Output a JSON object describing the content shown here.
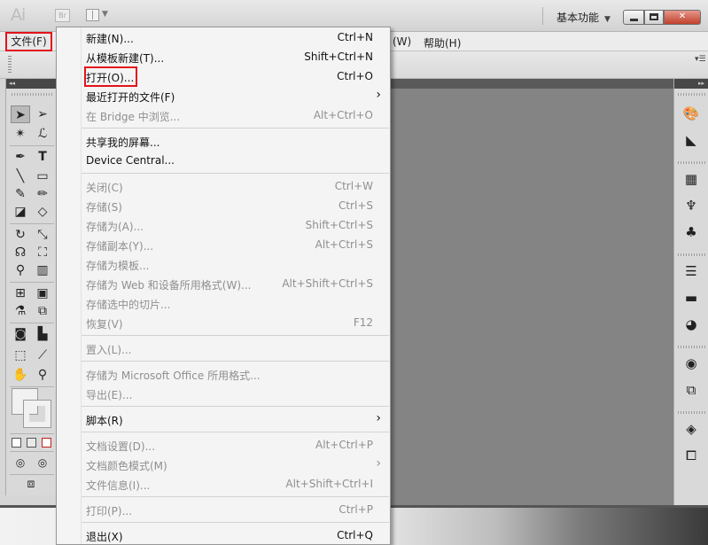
{
  "app": {
    "logo": "Ai",
    "bridge_label": "Br",
    "workspace": "基本功能"
  },
  "menubar": {
    "file": "文件(F)",
    "window": "(W)",
    "help": "帮助(H)"
  },
  "file_menu": {
    "items": [
      {
        "label": "新建(N)...",
        "shortcut": "Ctrl+N",
        "enabled": true
      },
      {
        "label": "从模板新建(T)...",
        "shortcut": "Shift+Ctrl+N",
        "enabled": true
      },
      {
        "label": "打开(O)...",
        "shortcut": "Ctrl+O",
        "enabled": true,
        "highlighted": true
      },
      {
        "label": "最近打开的文件(F)",
        "shortcut": "",
        "enabled": true,
        "submenu": true
      },
      {
        "label": "在 Bridge 中浏览...",
        "shortcut": "Alt+Ctrl+O",
        "enabled": false
      },
      {
        "label": "共享我的屏幕...",
        "shortcut": "",
        "enabled": true
      },
      {
        "label": "Device Central...",
        "shortcut": "",
        "enabled": true
      },
      {
        "label": "关闭(C)",
        "shortcut": "Ctrl+W",
        "enabled": false
      },
      {
        "label": "存储(S)",
        "shortcut": "Ctrl+S",
        "enabled": false
      },
      {
        "label": "存储为(A)...",
        "shortcut": "Shift+Ctrl+S",
        "enabled": false
      },
      {
        "label": "存储副本(Y)...",
        "shortcut": "Alt+Ctrl+S",
        "enabled": false
      },
      {
        "label": "存储为模板...",
        "shortcut": "",
        "enabled": false
      },
      {
        "label": "存储为 Web 和设备所用格式(W)...",
        "shortcut": "Alt+Shift+Ctrl+S",
        "enabled": false
      },
      {
        "label": "存储选中的切片...",
        "shortcut": "",
        "enabled": false
      },
      {
        "label": "恢复(V)",
        "shortcut": "F12",
        "enabled": false
      },
      {
        "label": "置入(L)...",
        "shortcut": "",
        "enabled": false
      },
      {
        "label": "存储为 Microsoft Office 所用格式...",
        "shortcut": "",
        "enabled": false
      },
      {
        "label": "导出(E)...",
        "shortcut": "",
        "enabled": false
      },
      {
        "label": "脚本(R)",
        "shortcut": "",
        "enabled": true,
        "submenu": true
      },
      {
        "label": "文档设置(D)...",
        "shortcut": "Alt+Ctrl+P",
        "enabled": false
      },
      {
        "label": "文档颜色模式(M)",
        "shortcut": "",
        "enabled": false,
        "submenu": true
      },
      {
        "label": "文件信息(I)...",
        "shortcut": "Alt+Shift+Ctrl+I",
        "enabled": false
      },
      {
        "label": "打印(P)...",
        "shortcut": "Ctrl+P",
        "enabled": false
      },
      {
        "label": "退出(X)",
        "shortcut": "Ctrl+Q",
        "enabled": true
      }
    ]
  },
  "toolbar": {
    "tools": [
      "selection-tool",
      "direct-selection-tool",
      "magic-wand-tool",
      "lasso-tool",
      "pen-tool",
      "type-tool",
      "line-segment-tool",
      "rectangle-tool",
      "paintbrush-tool",
      "pencil-tool",
      "blob-brush-tool",
      "eraser-tool",
      "rotate-tool",
      "scale-tool",
      "warp-tool",
      "free-transform-tool",
      "shape-builder-tool",
      "symbol-sprayer-tool",
      "mesh-tool",
      "gradient-tool",
      "eyedropper-tool",
      "blend-tool",
      "live-paint-tool",
      "column-graph-tool",
      "artboard-tool",
      "slice-tool",
      "hand-tool",
      "zoom-tool"
    ]
  },
  "dock": {
    "icons": [
      "color-guide-icon",
      "swatches-icon",
      "brushes-icon",
      "symbols-icon",
      "graphic-styles-icon",
      "stroke-icon",
      "gradient-icon",
      "transparency-icon",
      "appearance-icon",
      "align-icon",
      "layers-icon",
      "artboards-icon"
    ]
  },
  "colors": {
    "highlight_border": "#e3121b",
    "canvas": "#848484",
    "menu_bg": "#f4f4f4",
    "disabled_text": "#8f8f8f"
  }
}
